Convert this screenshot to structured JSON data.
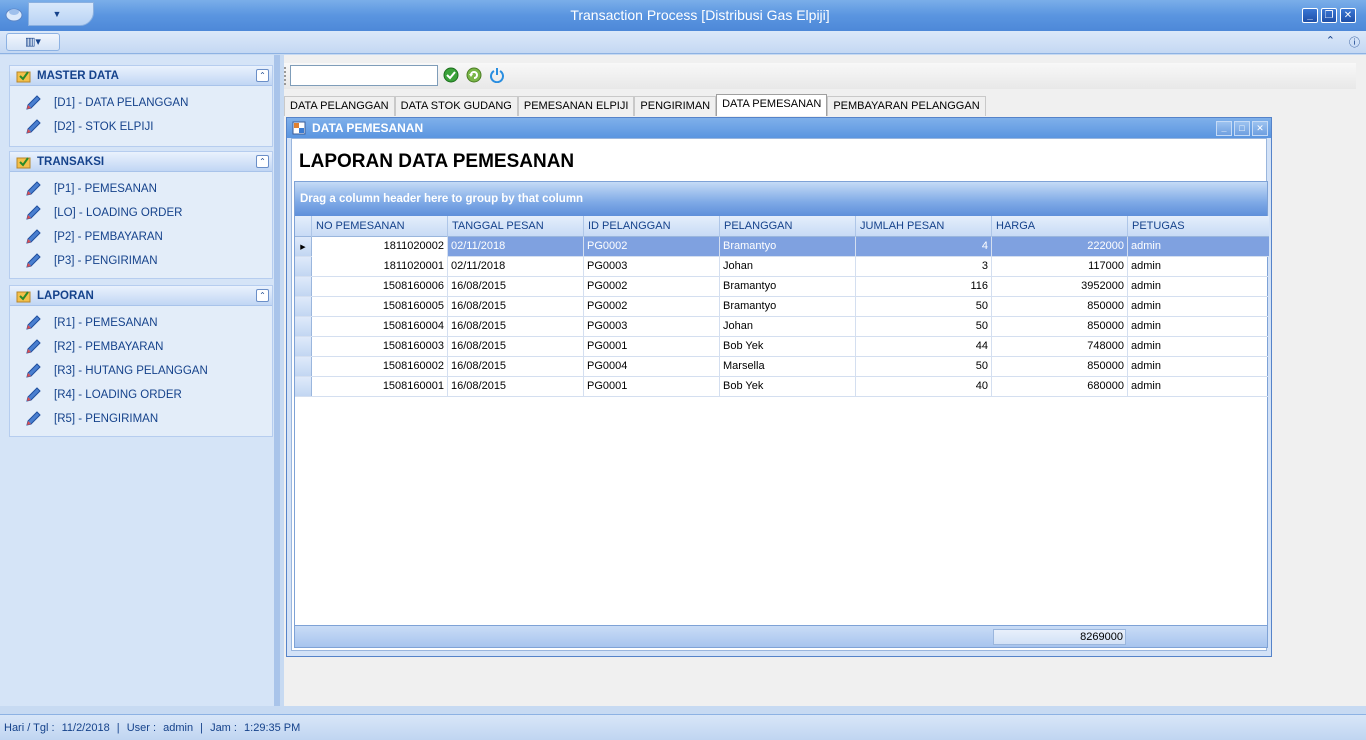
{
  "window": {
    "title": "Transaction Process [Distribusi Gas Elpiji]"
  },
  "nav": {
    "groups": [
      {
        "title": "MASTER DATA",
        "items": [
          "[D1] - DATA PELANGGAN",
          "[D2] - STOK ELPIJI"
        ]
      },
      {
        "title": "TRANSAKSI",
        "items": [
          "[P1] - PEMESANAN",
          "[LO] - LOADING ORDER",
          "[P2] - PEMBAYARAN",
          "[P3] - PENGIRIMAN"
        ]
      },
      {
        "title": "LAPORAN",
        "items": [
          "[R1] - PEMESANAN",
          "[R2] - PEMBAYARAN",
          "[R3] - HUTANG PELANGGAN",
          "[R4] - LOADING ORDER",
          "[R5] - PENGIRIMAN"
        ]
      }
    ]
  },
  "toolbar": {
    "search_value": ""
  },
  "tabs": [
    "DATA PELANGGAN",
    "DATA STOK GUDANG",
    "PEMESANAN ELPIJI",
    "PENGIRIMAN",
    "DATA PEMESANAN",
    "PEMBAYARAN PELANGGAN"
  ],
  "child": {
    "title": "DATA PEMESANAN",
    "report_title": "LAPORAN DATA PEMESANAN",
    "group_hint": "Drag a column header here to group by that column",
    "columns": [
      "NO PEMESANAN",
      "TANGGAL PESAN",
      "ID PELANGGAN",
      "PELANGGAN",
      "JUMLAH PESAN",
      "HARGA",
      "PETUGAS"
    ],
    "rows": [
      [
        "1811020002",
        "02/11/2018",
        "PG0002",
        "Bramantyo",
        "4",
        "222000",
        "admin"
      ],
      [
        "1811020001",
        "02/11/2018",
        "PG0003",
        "Johan",
        "3",
        "117000",
        "admin"
      ],
      [
        "1508160006",
        "16/08/2015",
        "PG0002",
        "Bramantyo",
        "116",
        "3952000",
        "admin"
      ],
      [
        "1508160005",
        "16/08/2015",
        "PG0002",
        "Bramantyo",
        "50",
        "850000",
        "admin"
      ],
      [
        "1508160004",
        "16/08/2015",
        "PG0003",
        "Johan",
        "50",
        "850000",
        "admin"
      ],
      [
        "1508160003",
        "16/08/2015",
        "PG0001",
        "Bob Yek",
        "44",
        "748000",
        "admin"
      ],
      [
        "1508160002",
        "16/08/2015",
        "PG0004",
        "Marsella",
        "50",
        "850000",
        "admin"
      ],
      [
        "1508160001",
        "16/08/2015",
        "PG0001",
        "Bob Yek",
        "40",
        "680000",
        "admin"
      ]
    ],
    "total_harga": "8269000"
  },
  "status": {
    "date_label": "Hari / Tgl :",
    "date_value": "11/2/2018",
    "user_label": "User :",
    "user_value": "admin",
    "time_label": "Jam :",
    "time_value": "1:29:35 PM"
  }
}
